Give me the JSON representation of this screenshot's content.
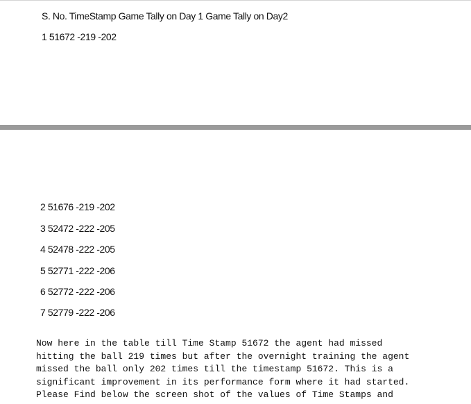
{
  "table": {
    "header": "S. No. TimeStamp Game Tally on Day 1 Game Tally on Day2",
    "rows": [
      "1 51672 -219 -202",
      "2 51676 -219 -202",
      "3 52472 -222 -205",
      "4 52478 -222 -205",
      "5 52771 -222 -206",
      "6 52772 -222 -206",
      "7 52779 -222 -206"
    ]
  },
  "paragraph": {
    "lines": [
      "Now here in the table till Time Stamp 51672 the agent had missed",
      "hitting the ball 219 times but after the overnight training the agent",
      "missed the ball only 202 times till the timestamp 51672. This is a",
      "significant improvement in its performance form where it had started.",
      "Please Find below the screen shot of the values of Time Stamps and"
    ]
  }
}
